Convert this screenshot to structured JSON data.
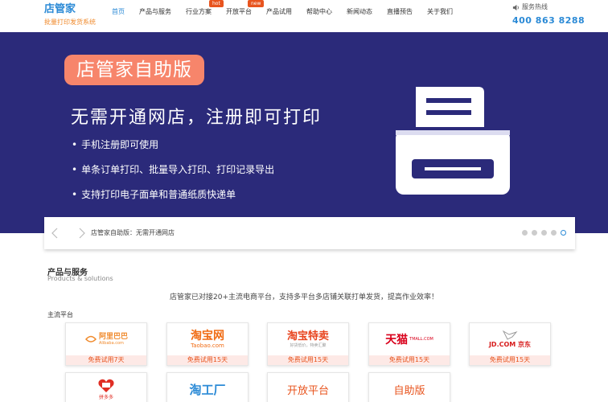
{
  "header": {
    "logo_title": "店管家",
    "logo_subtitle": "批量打印发货系统",
    "nav": [
      {
        "label": "首页",
        "active": true
      },
      {
        "label": "产品与服务"
      },
      {
        "label": "行业方案"
      },
      {
        "label": "开放平台",
        "badge": "hot"
      },
      {
        "label": "产品试用",
        "badge": "new"
      },
      {
        "label": "帮助中心"
      },
      {
        "label": "新闻动态"
      },
      {
        "label": "直播预告"
      },
      {
        "label": "关于我们"
      }
    ],
    "badges": {
      "hot": "hot",
      "new": "new"
    },
    "hotline_label": "服务热线",
    "hotline_number": "400 863 8288"
  },
  "banner": {
    "tag": "店管家自助版",
    "headline": "无需开通网店，注册即可打印",
    "bullets": [
      "手机注册即可使用",
      "单条订单打印、批量导入打印、打印记录导出",
      "支持打印电子面单和普通纸质快递单"
    ],
    "bg_color": "#2b2a7a",
    "tag_color": "#f7856b"
  },
  "slider": {
    "caption": "店管家自助版：无需开通网店",
    "dot_count": 5,
    "active_dot": 5
  },
  "products": {
    "title": "产品与服务",
    "subtitle": "Products & solutions",
    "description": "店管家已对接20+主流电商平台，支持多平台多店铺关联打单发货，提高作业效率！",
    "platform_label": "主流平台",
    "cards": [
      {
        "name": "阿里巴巴",
        "sub": "Alibaba.com",
        "trial": "免费试用7天",
        "color": "#f08a2c"
      },
      {
        "name": "淘宝网",
        "sub": "Taobao.com",
        "trial": "免费试用15天",
        "color": "#f06b13"
      },
      {
        "name": "淘宝特卖",
        "sub": "好货低价，特卖汇聚",
        "trial": "免费试用15天",
        "color": "#e8451f"
      },
      {
        "name": "天猫",
        "sub": "TMALL.COM",
        "trial": "免费试用15天",
        "color": "#d9001b"
      },
      {
        "name": "JD.COM 京东",
        "sub": "",
        "trial": "免费试用15天",
        "color": "#d71c1c"
      }
    ],
    "cards_row2": [
      {
        "name": "拼多多",
        "color": "#e02e24"
      },
      {
        "name": "淘工厂",
        "color": "#2b8ad6"
      },
      {
        "name": "开放平台",
        "color": "#e8541e"
      },
      {
        "name": "自助版",
        "color": "#e8541e"
      }
    ]
  },
  "accent": "#2b8ad6"
}
